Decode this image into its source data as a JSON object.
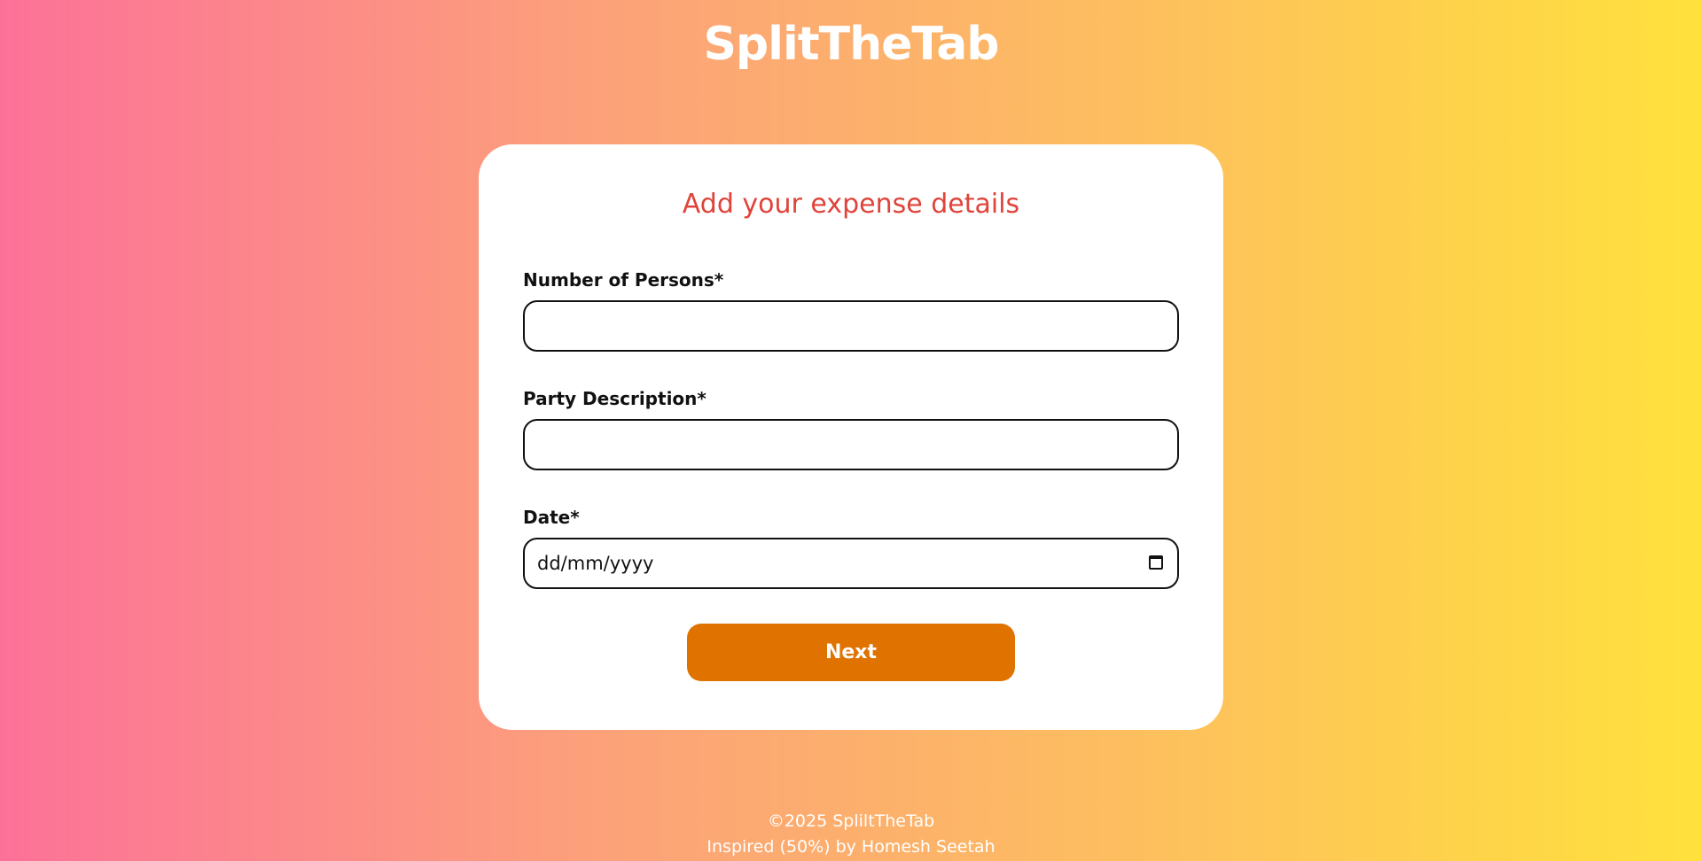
{
  "header": {
    "logo_text": "SplitTheTab"
  },
  "form": {
    "title": "Add your expense details",
    "fields": [
      {
        "label": "Number of Persons*",
        "value": "",
        "placeholder": ""
      },
      {
        "label": "Party Description*",
        "value": "",
        "placeholder": ""
      },
      {
        "label": "Date*",
        "value": "dd/mm/yyyy"
      }
    ],
    "next_label": "Next"
  },
  "footer": {
    "copyright": "©2025 SpliltTheTab",
    "credit": "Inspired (50%) by Homesh Seetah"
  },
  "colors": {
    "gradient_start": "#fc7198",
    "gradient_end": "#ffe13c",
    "title_color": "#e0433a",
    "button_color": "#e07200"
  }
}
